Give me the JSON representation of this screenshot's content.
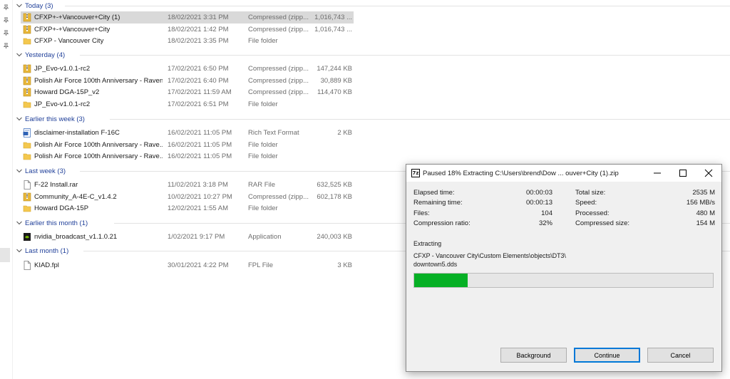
{
  "groups": [
    {
      "header": "Today (3)",
      "rows": [
        {
          "name": "CFXP+-+Vancouver+City (1)",
          "date": "18/02/2021 3:31 PM",
          "type": "Compressed (zipp...",
          "size": "1,016,743 ...",
          "icon": "zip-folder-icon",
          "selected": true
        },
        {
          "name": "CFXP+-+Vancouver+City",
          "date": "18/02/2021 1:42 PM",
          "type": "Compressed (zipp...",
          "size": "1,016,743 ...",
          "icon": "zip-folder-icon"
        },
        {
          "name": "CFXP - Vancouver City",
          "date": "18/02/2021 3:35 PM",
          "type": "File folder",
          "size": "",
          "icon": "folder-icon"
        }
      ]
    },
    {
      "header": "Yesterday (4)",
      "rows": [
        {
          "name": "JP_Evo-v1.0.1-rc2",
          "date": "17/02/2021 6:50 PM",
          "type": "Compressed (zipp...",
          "size": "147,244 KB",
          "icon": "zip-folder-icon"
        },
        {
          "name": "Polish Air Force 100th Anniversary - Raven",
          "date": "17/02/2021 6:40 PM",
          "type": "Compressed (zipp...",
          "size": "30,889 KB",
          "icon": "zip-folder-icon"
        },
        {
          "name": "Howard DGA-15P_v2",
          "date": "17/02/2021 11:59 AM",
          "type": "Compressed (zipp...",
          "size": "114,470 KB",
          "icon": "zip-folder-icon"
        },
        {
          "name": "JP_Evo-v1.0.1-rc2",
          "date": "17/02/2021 6:51 PM",
          "type": "File folder",
          "size": "",
          "icon": "folder-icon"
        }
      ]
    },
    {
      "header": "Earlier this week (3)",
      "rows": [
        {
          "name": "disclaimer-installation F-16C",
          "date": "16/02/2021 11:05 PM",
          "type": "Rich Text Format",
          "size": "2 KB",
          "icon": "rtf-document-icon"
        },
        {
          "name": "Polish Air Force 100th Anniversary - Rave...",
          "date": "16/02/2021 11:05 PM",
          "type": "File folder",
          "size": "",
          "icon": "folder-icon"
        },
        {
          "name": "Polish Air Force 100th Anniversary - Rave...",
          "date": "16/02/2021 11:05 PM",
          "type": "File folder",
          "size": "",
          "icon": "folder-icon"
        }
      ]
    },
    {
      "header": "Last week (3)",
      "rows": [
        {
          "name": "F-22 Install.rar",
          "date": "11/02/2021 3:18 PM",
          "type": "RAR File",
          "size": "632,525 KB",
          "icon": "file-icon"
        },
        {
          "name": "Community_A-4E-C_v1.4.2",
          "date": "10/02/2021 10:27 PM",
          "type": "Compressed (zipp...",
          "size": "602,178 KB",
          "icon": "zip-folder-icon"
        },
        {
          "name": "Howard DGA-15P",
          "date": "12/02/2021 1:55 AM",
          "type": "File folder",
          "size": "",
          "icon": "folder-icon"
        }
      ]
    },
    {
      "header": "Earlier this month (1)",
      "rows": [
        {
          "name": "nvidia_broadcast_v1.1.0.21",
          "date": "1/02/2021 9:17 PM",
          "type": "Application",
          "size": "240,003 KB",
          "icon": "nvidia-app-icon"
        }
      ]
    },
    {
      "header": "Last month (1)",
      "rows": [
        {
          "name": "KIAD.fpl",
          "date": "30/01/2021 4:22 PM",
          "type": "FPL File",
          "size": "3 KB",
          "icon": "file-icon"
        }
      ]
    }
  ],
  "dialog": {
    "app_icon_text": "7z",
    "title": "Paused 18% Extracting C:\\Users\\brend\\Dow ... ouver+City (1).zip",
    "left_stats": [
      {
        "label": "Elapsed time:",
        "value": "00:00:03"
      },
      {
        "label": "Remaining time:",
        "value": "00:00:13"
      },
      {
        "label": "Files:",
        "value": "104"
      },
      {
        "label": "Compression ratio:",
        "value": "32%"
      }
    ],
    "right_stats": [
      {
        "label": "Total size:",
        "value": "2535 M"
      },
      {
        "label": "Speed:",
        "value": "156 MB/s"
      },
      {
        "label": "Processed:",
        "value": "480 M"
      },
      {
        "label": "Compressed size:",
        "value": "154 M"
      }
    ],
    "extracting_label": "Extracting",
    "current_path": "CFXP - Vancouver City\\Custom Elements\\objects\\DT3\\ downtown5.dds",
    "progress_fraction": 0.18,
    "buttons": {
      "background": "Background",
      "continue": "Continue",
      "cancel": "Cancel"
    }
  },
  "colors": {
    "group_header": "#1f3f99",
    "progress": "#06b025",
    "zip_folder": "#e8b73a",
    "folder": "#f4c84f"
  }
}
